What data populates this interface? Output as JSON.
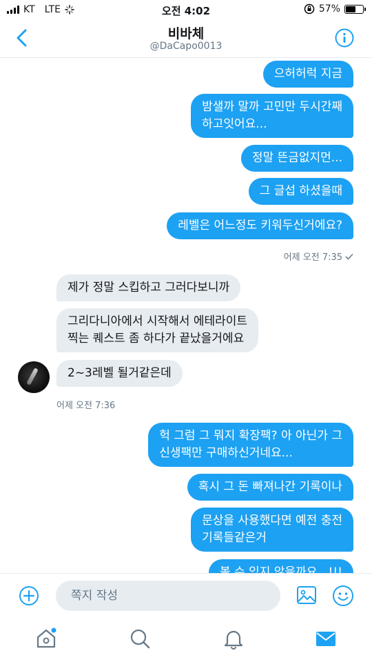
{
  "status_bar": {
    "carrier": "KT",
    "network": "LTE",
    "time": "오전 4:02",
    "battery_percent": "57%",
    "battery_level": 0.57
  },
  "header": {
    "title": "비바체",
    "handle": "@DaCapo0013"
  },
  "messages": {
    "sent_1": [
      "으허허럭 지금",
      "밤샐까 말까 고민만 두시간째 하고잇어요...",
      "정말 뜬금없지먼...",
      "그 글섭 하셨을때",
      "레벨은 어느정도 키워두신거에요?"
    ],
    "sent_1_line2": "하고잇어요...",
    "sent_1_line1": "밤샐까 말까 고민만 두시간째",
    "sent_1_time": "어제 오전 7:35",
    "recv_1": [
      "제가 정말 스킵하고 그러다보니까",
      "그리다니아에서 시작해서 에테라이트",
      "찍는 퀘스트 좀 하다가 끝났을거에요",
      "2~3레벨 될거같은데"
    ],
    "recv_1_time": "어제 오전 7:36",
    "sent_2": [
      "헉 그럼 그 뭐지 확장팩? 아 아닌가 그",
      "신생팩만 구매하신거네요...",
      "혹시 그 돈 빠져나간 기록이나",
      "문상을 사용했다면 예전 충전",
      "기록들같은거",
      "볼 수 있지 않을까요...!!!"
    ]
  },
  "composer": {
    "placeholder": "쪽지 작성"
  },
  "colors": {
    "accent": "#1da1f2",
    "received_bubble": "#e6ecf0",
    "muted_text": "#657786"
  },
  "icons": [
    "back-chevron-icon",
    "info-icon",
    "add-circle-icon",
    "image-icon",
    "emoji-icon",
    "home-icon",
    "search-icon",
    "notifications-bell-icon",
    "messages-envelope-icon"
  ]
}
